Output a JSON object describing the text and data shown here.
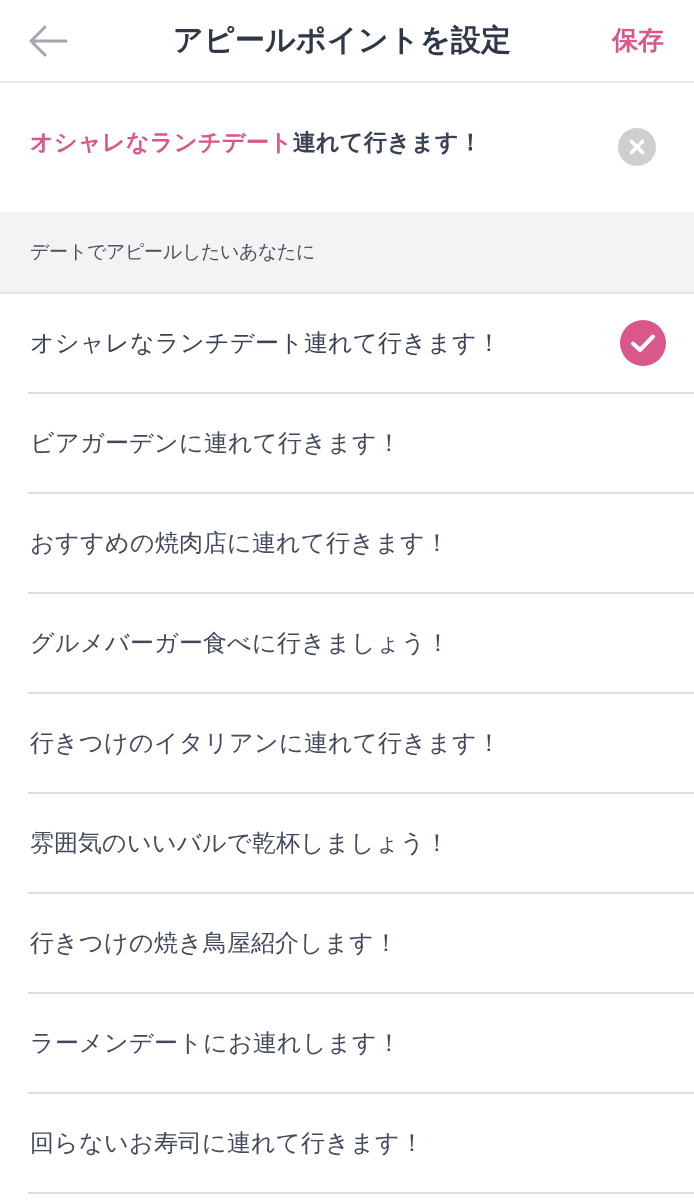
{
  "header": {
    "title": "アピールポイントを設定",
    "save": "保存"
  },
  "current": {
    "highlight": "オシャレなランチデート",
    "text": "連れて行きます！"
  },
  "section": {
    "title": "デートでアピールしたいあなたに"
  },
  "options": [
    {
      "label": "オシャレなランチデート連れて行きます！",
      "selected": true
    },
    {
      "label": "ビアガーデンに連れて行きます！",
      "selected": false
    },
    {
      "label": "おすすめの焼肉店に連れて行きます！",
      "selected": false
    },
    {
      "label": "グルメバーガー食べに行きましょう！",
      "selected": false
    },
    {
      "label": "行きつけのイタリアンに連れて行きます！",
      "selected": false
    },
    {
      "label": "雰囲気のいいバルで乾杯しましょう！",
      "selected": false
    },
    {
      "label": "行きつけの焼き鳥屋紹介します！",
      "selected": false
    },
    {
      "label": "ラーメンデートにお連れします！",
      "selected": false
    },
    {
      "label": "回らないお寿司に連れて行きます！",
      "selected": false
    }
  ]
}
